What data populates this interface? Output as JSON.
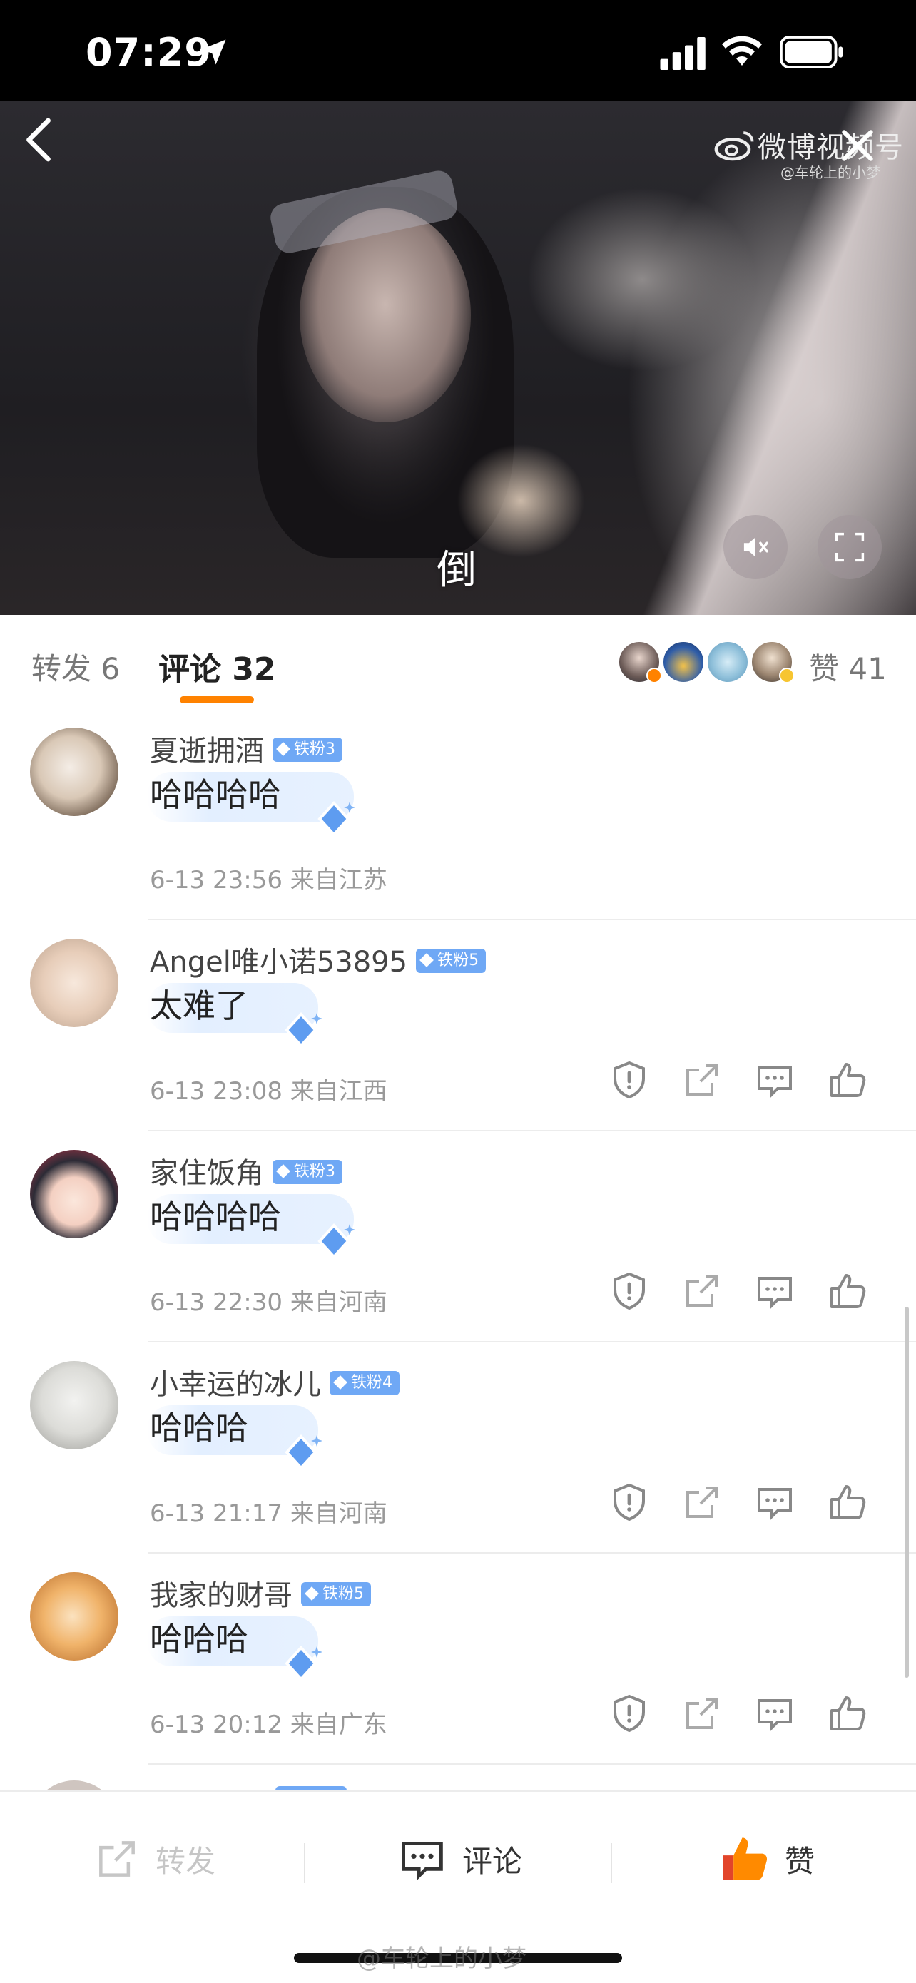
{
  "status_bar": {
    "time": "07:29"
  },
  "video": {
    "brand": "微博视频号",
    "brand_sub": "@车轮上的小梦",
    "subtitle": "倒"
  },
  "tabs": {
    "repost": "转发 6",
    "comment": "评论 32",
    "like": "赞 41"
  },
  "comments": [
    {
      "user": "夏逝拥酒",
      "badge": "铁粉3",
      "text": "哈哈哈哈",
      "meta": "6-13 23:56  来自江苏"
    },
    {
      "user": "Angel唯小诺53895",
      "badge": "铁粉5",
      "text": "太难了",
      "meta": "6-13 23:08  来自江西"
    },
    {
      "user": "家住饭角",
      "badge": "铁粉3",
      "text": "哈哈哈哈",
      "meta": "6-13 22:30  来自河南"
    },
    {
      "user": "小幸运的冰儿",
      "badge": "铁粉4",
      "text": "哈哈哈",
      "meta": "6-13 21:17  来自河南"
    },
    {
      "user": "我家的财哥",
      "badge": "铁粉5",
      "text": "哈哈哈",
      "meta": "6-13 20:12  来自广东"
    }
  ],
  "bottom_bar": {
    "repost": "转发",
    "comment": "评论",
    "like": "赞"
  },
  "watermark": "@车轮上的小梦",
  "colors": {
    "accent": "#ff8200",
    "badge": "#6fa8f5",
    "like_orange": "#ff6a00"
  },
  "icons": [
    "location-arrow-icon",
    "signal-icon",
    "wifi-icon",
    "battery-icon",
    "back-icon",
    "weibo-logo-icon",
    "close-icon",
    "mute-icon",
    "fullscreen-icon",
    "report-icon",
    "share-icon",
    "reply-icon",
    "thumbs-up-icon",
    "repost-icon",
    "comment-icon"
  ]
}
